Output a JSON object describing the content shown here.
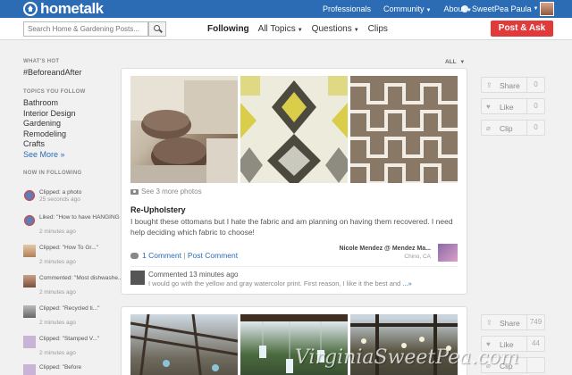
{
  "brand": {
    "name": "hometalk"
  },
  "topnav": {
    "professionals": "Professionals",
    "community": "Community",
    "about": "About",
    "user": "SweetPea Paula"
  },
  "search": {
    "placeholder": "Search Home & Gardening Posts..."
  },
  "subnav": {
    "following": "Following",
    "all_topics": "All Topics",
    "questions": "Questions",
    "clips": "Clips"
  },
  "post_button": "Post & Ask",
  "sidebar": {
    "whats_hot_heading": "WHAT'S HOT",
    "hot_tag": "#BeforeandAfter",
    "topics_heading": "TOPICS YOU FOLLOW",
    "topics": [
      "Bathroom",
      "Interior Design",
      "Gardening",
      "Remodeling",
      "Crafts"
    ],
    "see_more": "See More »",
    "now_heading": "NOW IN FOLLOWING",
    "activity": [
      {
        "action": "Clipped: a photo",
        "time": "25 seconds ago"
      },
      {
        "action": "Liked: \"How to have HANGING FE...\"",
        "time": "2 minutes ago"
      },
      {
        "action": "Clipped: \"How To Gr...\"",
        "time": "2 minutes ago"
      },
      {
        "action": "Commented: \"Most dishwashe...\"",
        "time": "2 minutes ago"
      },
      {
        "action": "Clipped: \"Recycled ti...\"",
        "time": "2 minutes ago"
      },
      {
        "action": "Clipped: \"Stamped V...\"",
        "time": "2 minutes ago"
      },
      {
        "action": "Clipped: \"Before",
        "time": ""
      }
    ]
  },
  "feed_filter": "ALL",
  "post": {
    "see_more_photos": "See 3 more photos",
    "title": "Re-Upholstery",
    "description": "I bought these ottomans but I hate the fabric and am planning on having them recovered. I need help deciding which fabric to choose!",
    "comment_count_link": "1 Comment",
    "separator": " | ",
    "post_comment_link": "Post Comment",
    "author": "Nicole Mendez @ Mendez Ma...",
    "location": "Chino, CA",
    "latest_comment_header": "Commented 13 minutes ago",
    "latest_comment_text": "I would go with the yellow and gray watercolor print. First reason, I like it the best and",
    "more_link": "...»"
  },
  "actions_post1": {
    "share": "Share",
    "share_count": "0",
    "like": "Like",
    "like_count": "0",
    "clip": "Clip",
    "clip_count": "0"
  },
  "actions_post2": {
    "share": "Share",
    "share_count": "749",
    "like": "Like",
    "like_count": "44",
    "clip": "Clip",
    "clip_count": ""
  },
  "watermark": "VirginiaSweetPea.com"
}
